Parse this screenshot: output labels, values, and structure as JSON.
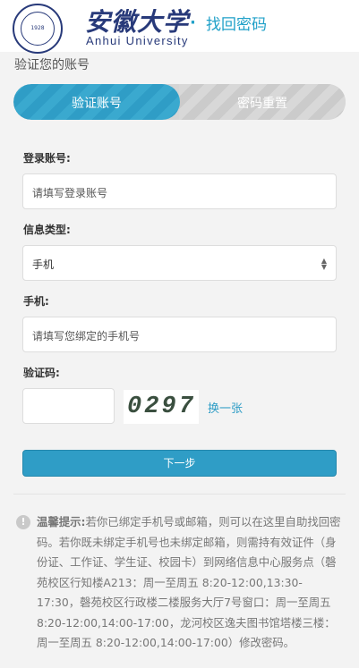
{
  "header": {
    "brand_cn": "安徽大学",
    "brand_en": "Anhui University",
    "separator": "·",
    "page_title": "找回密码",
    "logo_year": "1928"
  },
  "section_title": "验证您的账号",
  "steps": [
    {
      "label": "验证账号",
      "active": true
    },
    {
      "label": "密码重置",
      "active": false
    }
  ],
  "form": {
    "account_label": "登录账号:",
    "account_placeholder": "请填写登录账号",
    "type_label": "信息类型:",
    "type_value": "手机",
    "phone_label": "手机:",
    "phone_placeholder": "请填写您绑定的手机号",
    "captcha_label": "验证码:",
    "captcha_text": "0297",
    "refresh_label": "换一张",
    "next_label": "下一步"
  },
  "tips": {
    "title": "温馨提示:",
    "body": "若你已绑定手机号或邮箱，则可以在这里自助找回密码。若你既未绑定手机号也未绑定邮箱，则需持有效证件（身份证、工作证、学生证、校园卡）到网络信息中心服务点（磬苑校区行知楼A213：周一至周五 8:20-12:00,13:30-17:30，磬苑校区行政楼二楼服务大厅7号窗口：周一至周五 8:20-12:00,14:00-17:00，龙河校区逸夫图书馆塔楼三楼：周一至周五 8:20-12:00,14:00-17:00）修改密码。"
  },
  "colors": {
    "accent": "#2f9dc6",
    "brand": "#283a7a"
  }
}
